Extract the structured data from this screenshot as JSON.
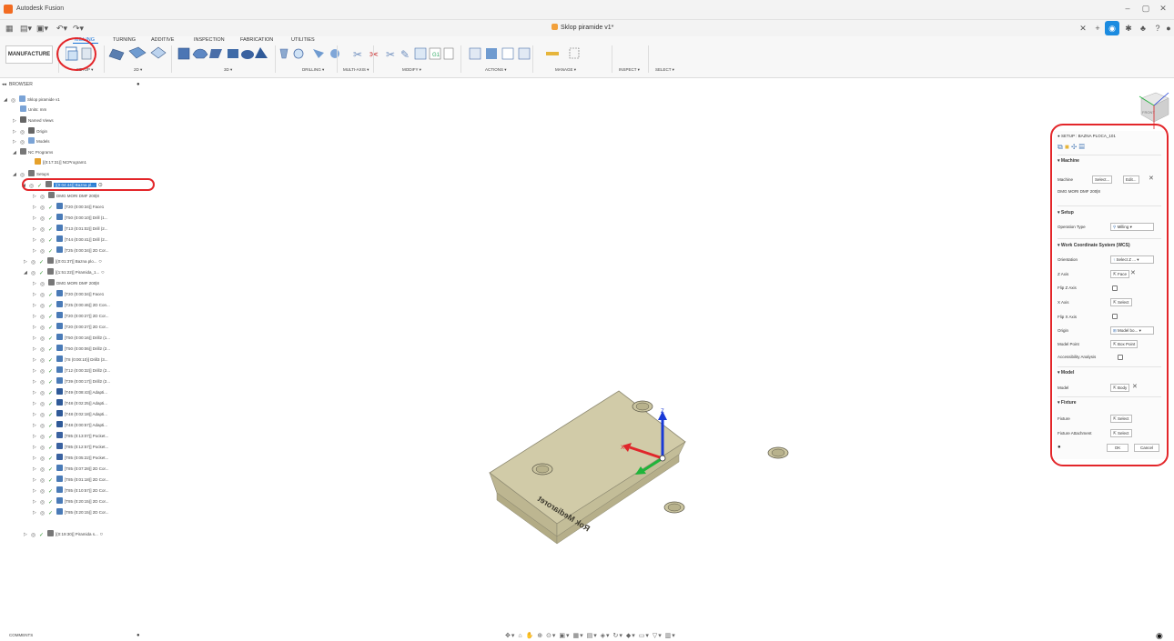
{
  "window": {
    "app_title": "Autodesk Fusion",
    "doc_title": "Sklop piramide v1*"
  },
  "ribbon": {
    "workspace": "MANUFACTURE",
    "tabs": [
      "MILLING",
      "TURNING",
      "ADDITIVE",
      "INSPECTION",
      "FABRICATION",
      "UTILITIES"
    ],
    "groups": [
      "SETUP ▾",
      "2D ▾",
      "3D ▾",
      "DRILLING ▾",
      "MULTI-AXIS ▾",
      "MODIFY ▾",
      "ACTIONS ▾",
      "MANAGE ▾",
      "INSPECT ▾",
      "SELECT ▾"
    ]
  },
  "browser": {
    "header": "BROWSER",
    "rows": [
      "Sklop piramide v1",
      "Units: mm",
      "Named Views",
      "Origin",
      "Models",
      "NC Programs",
      "[(0:17:31)] NCProgram1",
      "Setups",
      "[(0:04:44)] Bazna pl...",
      "DMG MORI DMF 200|8",
      "[T20 (0:00:34)] Face1",
      "[T50 (0:00:10)] Drill (1...",
      "[T13 (0:01:02)] Drill (2...",
      "[T44 (0:00:41)] Drill (2...",
      "[T25 (0:00:34)] 2D Cor...",
      "[(0:01:37)] Bazna plo...",
      "[(1:51:22)] Piramida_1...",
      "DMG MORI DMF 200|8",
      "[T20 (0:00:34)] Face1",
      "[T25 (0:00:46)] 2D Con...",
      "[T20 (0:00:27)] 2D Cor...",
      "[T20 (0:00:27)] 2D Cor...",
      "[T50 (0:00:16)] Drill2 (1...",
      "[T50 (0:00:06)] Drill2 (2...",
      "[T8 (0:00:10)] Drill3 (3...",
      "[T12 (0:00:32)] Drill2 (2...",
      "[T39 (0:00:17)] Drill2 (2...",
      "[T49 (0:08:43)] Adapti...",
      "[T48 (0:02:25)] Adapti...",
      "[T48 (0:02:18)] Adapti...",
      "[T48 (0:00:57)] Adapti...",
      "[T85 (0:13:07)] Pocket...",
      "[T85 (0:12:57)] Pocket...",
      "[T85 (0:05:22)] Pocket...",
      "[T85 (0:07:28)] 2D Cor...",
      "[T85 (0:01:18)] 2D Cor...",
      "[T85 (0:10:57)] 2D Cor...",
      "[T85 (0:20:15)] 2D Cor...",
      "[T85 (0:20:15)] 2D Cor...",
      "[(0:19:30)] Piramida s..."
    ]
  },
  "setup_panel": {
    "header": "SETUP : BAZNA PLOCA_101",
    "machine_section": "Machine",
    "machine_label": "Machine",
    "machine_select": "Select...",
    "machine_edit": "Edit...",
    "machine_name": "DMG MORI DMF 200|8",
    "setup_section": "Setup",
    "op_type_label": "Operation Type",
    "op_type_value": "Milling",
    "wcs_section": "Work Coordinate System (WCS)",
    "orientation_label": "Orientation",
    "orientation_value": "Select Z ...",
    "zaxis_label": "Z Axis",
    "zaxis_value": "Face",
    "flipz_label": "Flip Z Axis",
    "xaxis_label": "X Axis",
    "xaxis_value": "Select",
    "flipx_label": "Flip X Axis",
    "origin_label": "Origin",
    "origin_value": "Model bo...",
    "model_point_label": "Model Point",
    "model_point_value": "Box Point",
    "access_label": "Accessibility Analysis",
    "model_section": "Model",
    "model_label": "Model",
    "model_value": "Body",
    "fixture_section": "Fixture",
    "fixture_label": "Fixture",
    "fixture_value": "Select",
    "fixture_att_label": "Fixture Attachment",
    "fixture_att_value": "Select",
    "ok": "OK",
    "cancel": "Cancel"
  },
  "viewcube": {
    "label": "FRONT"
  },
  "model": {
    "engraving": "Rok Mediaroret"
  },
  "bottom": {
    "comments": "COMMENTS"
  },
  "colors": {
    "accent": "#1673d9",
    "annotation": "#e3262a",
    "part": "#cdc7a2"
  }
}
